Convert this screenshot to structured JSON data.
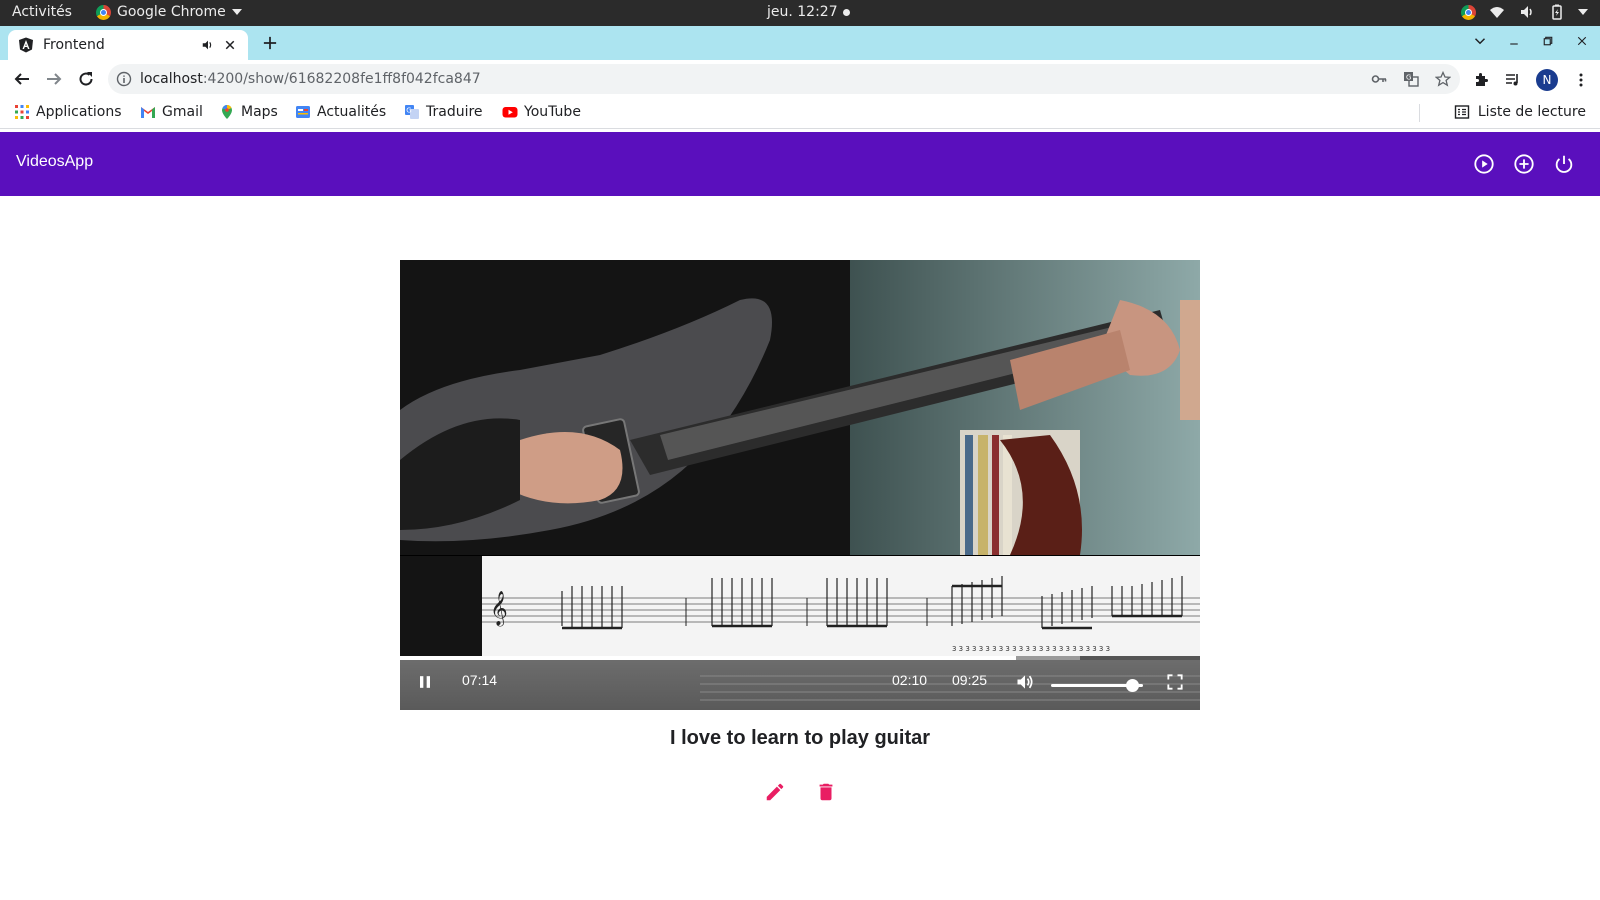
{
  "system_bar": {
    "activities": "Activités",
    "app_name": "Google Chrome",
    "clock": "jeu. 12:27"
  },
  "browser": {
    "tab_title": "Frontend",
    "url_host": "localhost",
    "url_path": ":4200/show/61682208fe1ff8f042fca847",
    "profile_initial": "N",
    "bookmarks": [
      "Applications",
      "Gmail",
      "Maps",
      "Actualités",
      "Traduire",
      "YouTube"
    ],
    "reading_list": "Liste de lecture"
  },
  "app": {
    "title": "VideosApp",
    "header_icons": [
      "play-circle-icon",
      "add-circle-icon",
      "power-icon"
    ],
    "accent_color": "#5a0fbd",
    "action_color": "#e91e63"
  },
  "video": {
    "current_time": "07:14",
    "remaining_time": "02:10",
    "duration": "09:25",
    "progress_fraction": 0.77,
    "volume_fraction": 0.88,
    "title": "I love to learn to play guitar"
  }
}
